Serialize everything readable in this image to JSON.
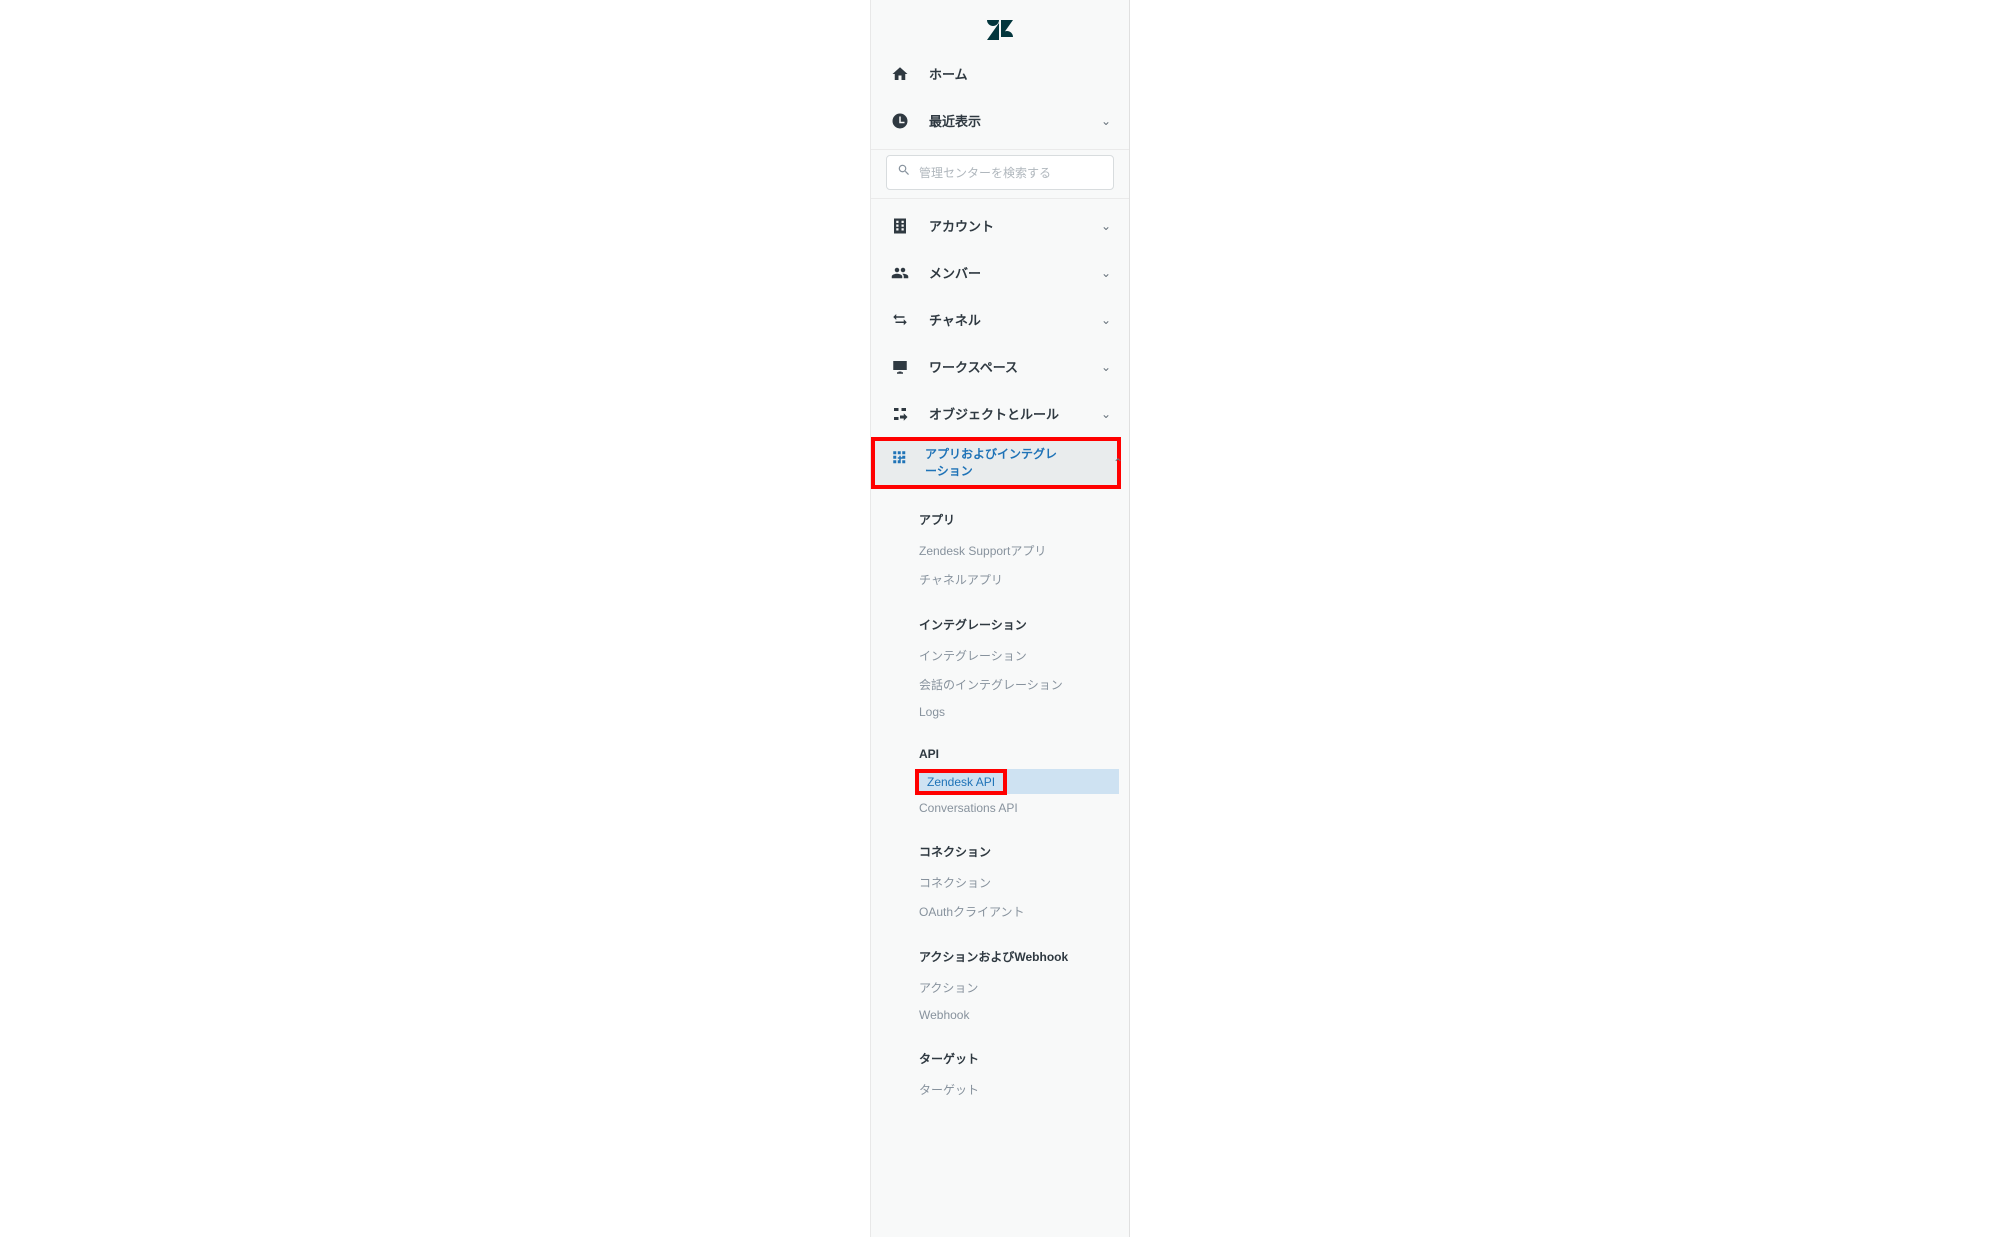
{
  "nav": {
    "home": "ホーム",
    "recent": "最近表示",
    "account": "アカウント",
    "members": "メンバー",
    "channels": "チャネル",
    "workspace": "ワークスペース",
    "objects_rules": "オブジェクトとルール",
    "apps_integrations": "アプリおよびインテグレーション"
  },
  "search": {
    "placeholder": "管理センターを検索する"
  },
  "sub": {
    "apps": {
      "head": "アプリ",
      "support_apps": "Zendesk Supportアプリ",
      "channel_apps": "チャネルアプリ"
    },
    "integrations": {
      "head": "インテグレーション",
      "integrations": "インテグレーション",
      "conversation_integrations": "会話のインテグレーション",
      "logs": "Logs"
    },
    "api": {
      "head": "API",
      "zendesk_api": "Zendesk API",
      "conversations_api": "Conversations API"
    },
    "connections": {
      "head": "コネクション",
      "connections": "コネクション",
      "oauth_clients": "OAuthクライアント"
    },
    "actions_webhook": {
      "head": "アクションおよびWebhook",
      "actions": "アクション",
      "webhook": "Webhook"
    },
    "targets": {
      "head": "ターゲット",
      "targets": "ターゲット"
    }
  }
}
